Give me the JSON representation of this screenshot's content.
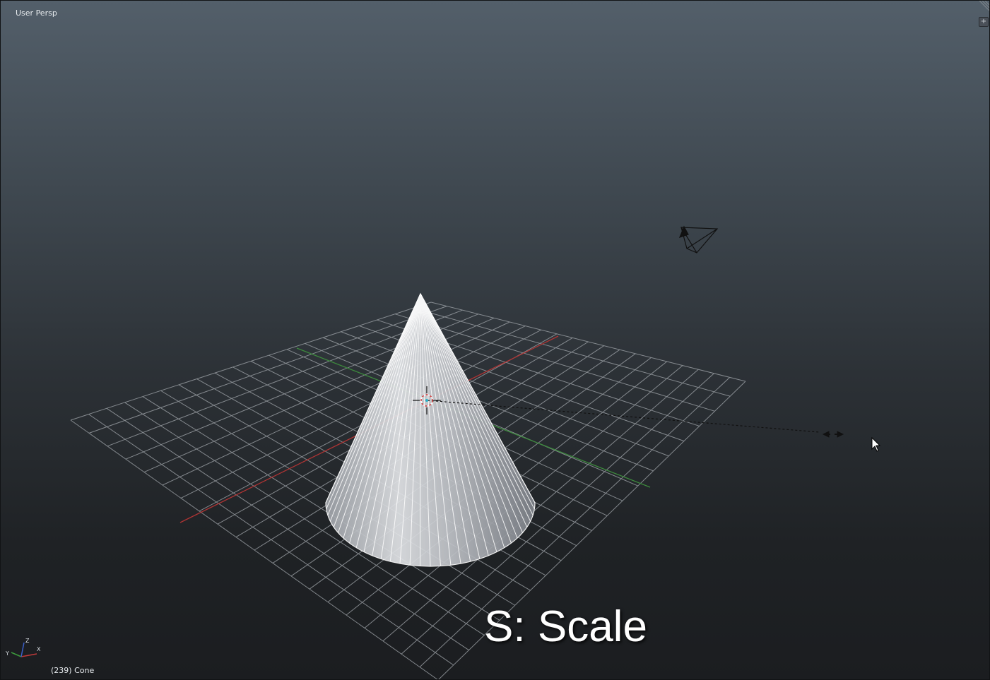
{
  "viewport": {
    "view_label": "User Persp",
    "object_info": "(239) Cone",
    "caption": "S: Scale"
  },
  "icons": {
    "axis_gizmo": "axis-gizmo-icon",
    "camera": "camera-icon",
    "cursor": "mouse-pointer-icon",
    "scale_arrows": "scale-arrows-icon",
    "cursor_3d": "3d-cursor-icon"
  },
  "colors": {
    "x_axis": "#b03434",
    "y_axis": "#3d8a3d",
    "grid": "#9aa0a6",
    "cone_fill": "#c9ccd1",
    "cone_edge": "#ffffff"
  }
}
